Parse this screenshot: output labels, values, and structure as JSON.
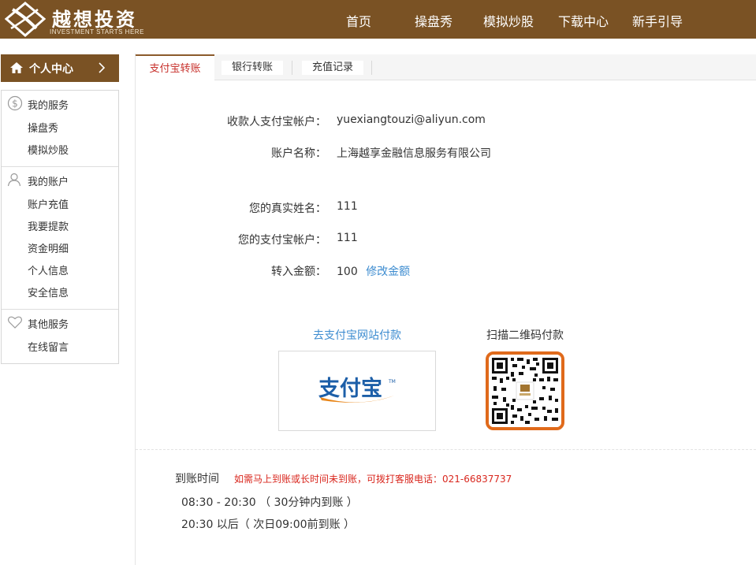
{
  "header": {
    "logo_title": "越想投资",
    "logo_subtitle": "INVESTMENT STARTS HERE",
    "nav": [
      "首页",
      "操盘秀",
      "模拟炒股",
      "下载中心",
      "新手引导"
    ]
  },
  "sidebar": {
    "head_label": "个人中心",
    "groups": [
      {
        "title": "我的服务",
        "icon": "dollar-icon",
        "items": [
          "操盘秀",
          "模拟炒股"
        ]
      },
      {
        "title": "我的账户",
        "icon": "user-icon",
        "items": [
          "账户充值",
          "我要提款",
          "资金明细",
          "个人信息",
          "安全信息"
        ]
      },
      {
        "title": "其他服务",
        "icon": "heart-icon",
        "items": [
          "在线留言"
        ]
      }
    ]
  },
  "tabs": [
    "支付宝转账",
    "银行转账",
    "充值记录"
  ],
  "form": {
    "payee_label": "收款人支付宝帐户：",
    "payee_value": "yuexiangtouzi@aliyun.com",
    "account_name_label": "账户名称：",
    "account_name_value": "上海越享金融信息服务有限公司",
    "real_name_label": "您的真实姓名：",
    "real_name_value": "111",
    "alipay_account_label": "您的支付宝帐户：",
    "alipay_account_value": "111",
    "amount_label": "转入金额：",
    "amount_value": "100",
    "modify_amount": "修改金额"
  },
  "payment": {
    "goto_alipay": "去支付宝网站付款",
    "qr_title": "扫描二维码付款",
    "alipay_logo_text": "支付宝",
    "alipay_tm": "TM"
  },
  "arrival": {
    "title": "到账时间",
    "note": "如需马上到账或长时间未到账，可拨打客服电话：021-66837737",
    "line1": "08:30 - 20:30 （ 30分钟内到账 ）",
    "line2": "20:30 以后（ 次日09:00前到账 ）"
  },
  "colors": {
    "brand_brown": "#7a5224",
    "active_tab_red": "#c7302b",
    "link_blue": "#3d8cd0",
    "qr_orange": "#e06a1b",
    "note_red": "#d9271e"
  }
}
